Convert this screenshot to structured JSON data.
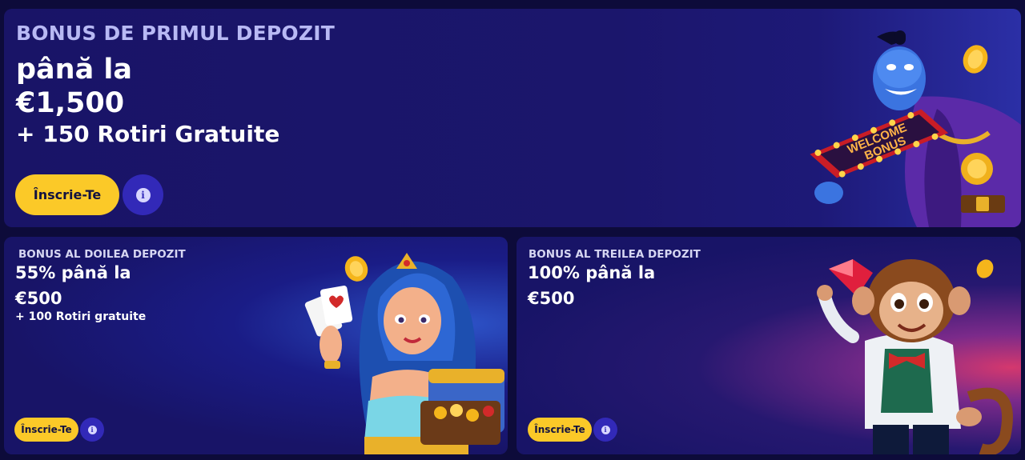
{
  "cards": {
    "main": {
      "eyebrow": "BONUS DE PRIMUL DEPOZIT",
      "line1": "până la",
      "line2": "€1,500",
      "line3": "+ 150 Rotiri Gratuite",
      "button_label": "Înscrie-Te",
      "info_label": "i",
      "sign_line1": "WELCOME",
      "sign_line2": "BONUS",
      "character_icon": "genie-character-icon"
    },
    "second": {
      "eyebrow": "BONUS AL DOILEA DEPOZIT",
      "line1": "55% până la",
      "line2": "€500",
      "line3": "+ 100 Rotiri gratuite",
      "button_label": "Înscrie-Te",
      "info_label": "i",
      "character_icon": "princess-character-icon"
    },
    "third": {
      "eyebrow": "BONUS AL TREILEA DEPOZIT",
      "line1": "100% până la",
      "line2": "€500",
      "button_label": "Înscrie-Te",
      "info_label": "i",
      "character_icon": "monkey-character-icon"
    }
  },
  "colors": {
    "background": "#0d0b3a",
    "card": "#191467",
    "accent_yellow": "#fbc928",
    "info_button": "#3229b8"
  }
}
